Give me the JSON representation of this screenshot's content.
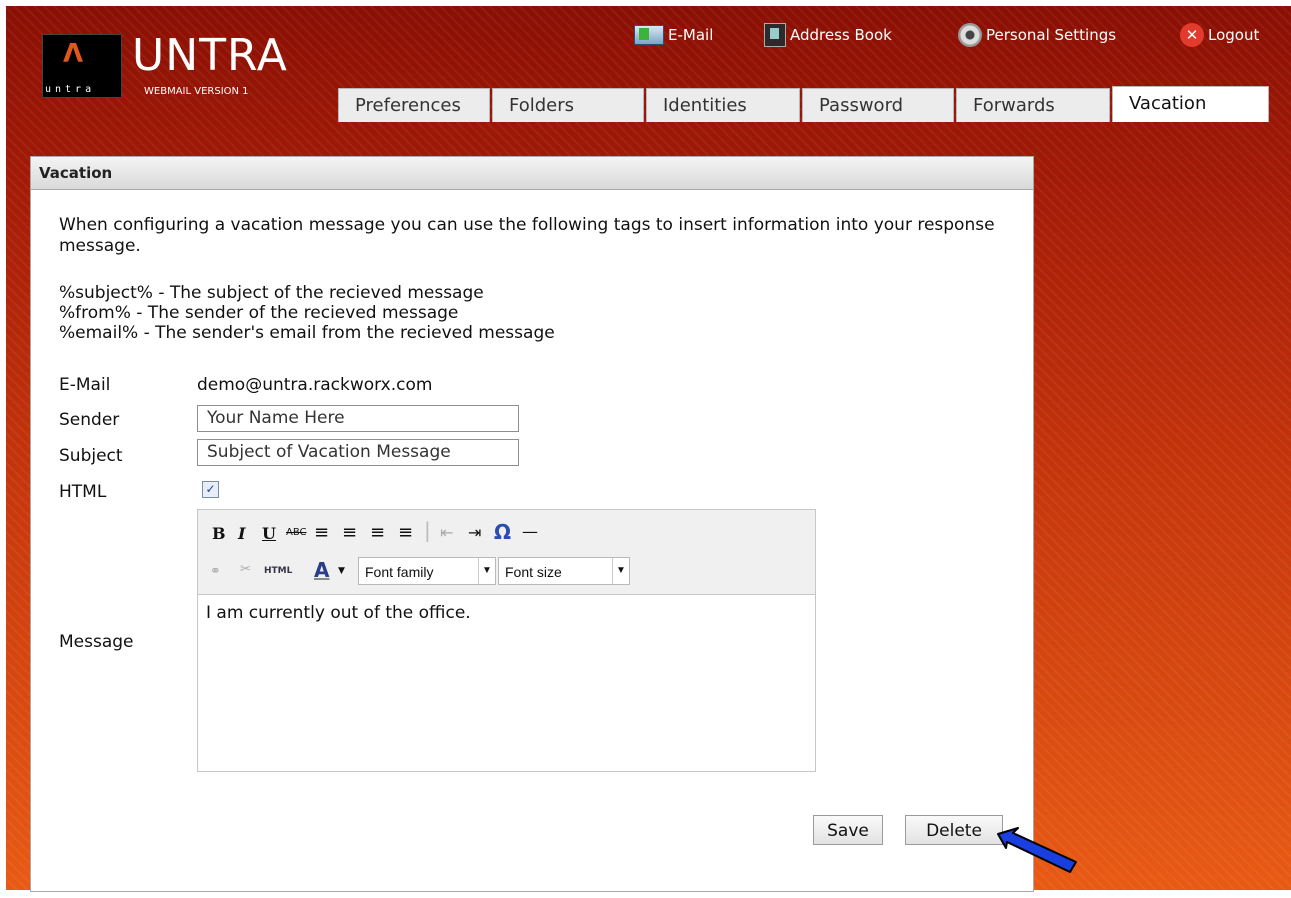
{
  "logo": {
    "caret": "Λ",
    "small": "untra",
    "title": "UNTRA",
    "subtitle": "WEBMAIL VERSION 1"
  },
  "topnav": [
    {
      "label": "E-Mail",
      "icon": "email-icon"
    },
    {
      "label": "Address Book",
      "icon": "address-book-icon"
    },
    {
      "label": "Personal Settings",
      "icon": "settings-gear-icon"
    },
    {
      "label": "Logout",
      "icon": "logout-icon",
      "glyph": "✕"
    }
  ],
  "tabs": [
    "Preferences",
    "Folders",
    "Identities",
    "Password",
    "Forwards",
    "Vacation"
  ],
  "active_tab": "Vacation",
  "panel": {
    "title": "Vacation",
    "intro": "When configuring a vacation message you can use the following tags to insert information into your response message.",
    "tags": [
      "%subject% - The subject of the recieved message",
      "%from% - The sender of the recieved message",
      "%email% - The sender's email from the recieved message"
    ],
    "form": {
      "email_label": "E-Mail",
      "email_value": "demo@untra.rackworx.com",
      "sender_label": "Sender",
      "sender_value": "Your Name Here",
      "subject_label": "Subject",
      "subject_value": "Subject of Vacation Message",
      "html_label": "HTML",
      "html_checked": true,
      "message_label": "Message"
    },
    "editor": {
      "toolbar_row1": [
        "B",
        "I",
        "U",
        "ABC",
        "≡",
        "≡",
        "≡",
        "≡",
        "⇤",
        "⇥",
        "Ω",
        "—"
      ],
      "html_button": "HTML",
      "color_button": "A",
      "font_family": "Font family",
      "font_size": "Font size",
      "content": "I am currently out of the office."
    },
    "buttons": {
      "save": "Save",
      "delete": "Delete"
    }
  },
  "colors": {
    "accent_arrow": "#1a3fe0",
    "background_dark": "#8a0f04",
    "background_light": "#e85a14"
  }
}
